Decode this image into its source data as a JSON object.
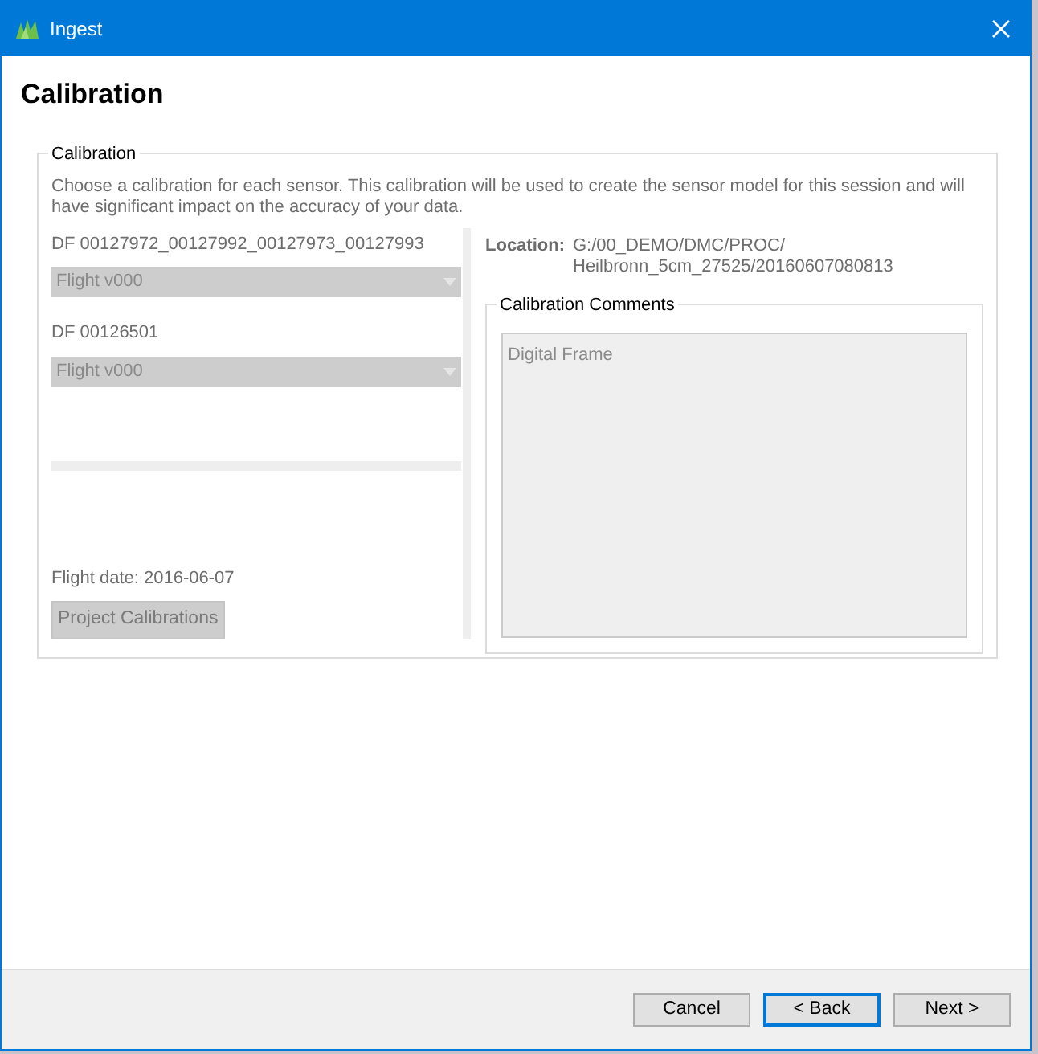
{
  "window": {
    "title": "Ingest"
  },
  "page_title": "Calibration",
  "group": {
    "legend": "Calibration",
    "description": "Choose a calibration for each sensor. This calibration will be used to create the sensor model for this session and will have significant impact on the accuracy of your data."
  },
  "sensors": [
    {
      "label": "DF 00127972_00127992_00127973_00127993",
      "value": "Flight v000",
      "disabled": true
    },
    {
      "label": "DF 00126501",
      "value": "Flight v000",
      "disabled": true
    }
  ],
  "flight_date": "Flight date: 2016-06-07",
  "project_calibrations": {
    "label": "Project Calibrations",
    "disabled": true
  },
  "location": {
    "label": "Location:",
    "lines": [
      "G:/00_DEMO/DMC/PROC/",
      "Heilbronn_5cm_27525/20160607080813"
    ]
  },
  "comments": {
    "legend": "Calibration Comments",
    "text": "Digital Frame",
    "disabled": true
  },
  "buttons": [
    {
      "label": "Cancel",
      "selected": false
    },
    {
      "label": "< Back",
      "selected": true
    },
    {
      "label": "Next >",
      "selected": false
    }
  ]
}
